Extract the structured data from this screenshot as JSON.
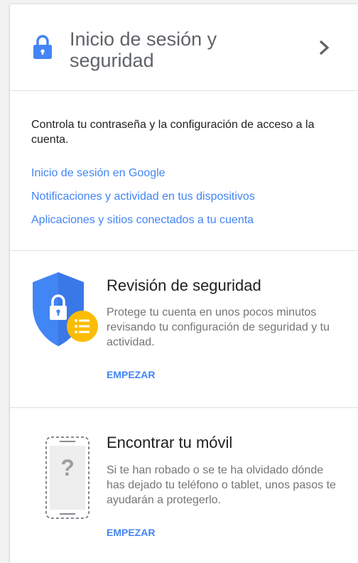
{
  "header": {
    "title": "Inicio de sesión y seguridad",
    "icon": "lock-icon",
    "chevron_icon": "chevron-right-icon"
  },
  "intro": {
    "description": "Controla tu contraseña y la configuración de acceso a la cuenta.",
    "links": [
      "Inicio de sesión en Google",
      "Notificaciones y actividad en tus dispositivos",
      "Aplicaciones y sitios conectados a tu cuenta"
    ]
  },
  "security_checkup": {
    "title": "Revisión de seguridad",
    "description": "Protege tu cuenta en unos pocos minutos revisando tu configuración de seguridad y tu actividad.",
    "action": "EMPEZAR",
    "icon": "security-shield-icon"
  },
  "find_phone": {
    "title": "Encontrar tu móvil",
    "description": "Si te han robado o se te ha olvidado dónde has dejado tu teléfono o tablet, unos pasos te ayudarán a protegerlo.",
    "action": "EMPEZAR",
    "icon": "phone-question-icon"
  },
  "colors": {
    "link_blue": "#4285f4",
    "shield_blue": "#4285f4",
    "badge_yellow": "#fbbc04",
    "title_gray": "#5f6368",
    "body_gray": "#757575"
  }
}
